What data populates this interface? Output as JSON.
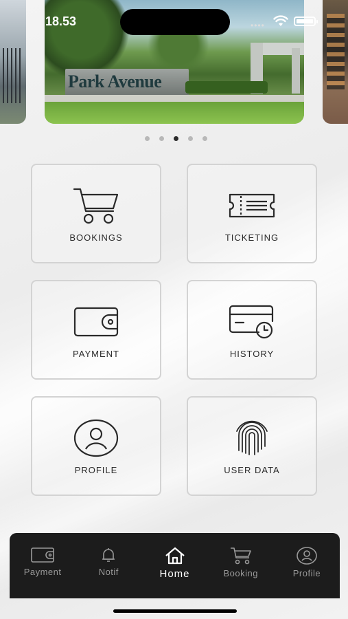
{
  "status_bar": {
    "time": "18.53"
  },
  "carousel": {
    "sign_text": "Park Avenue",
    "dot_count": 5,
    "active_index": 2
  },
  "menu": {
    "bookings": "BOOKINGS",
    "ticketing": "TICKETING",
    "payment": "PAYMENT",
    "history": "HISTORY",
    "profile": "PROFILE",
    "user_data": "USER DATA"
  },
  "nav": {
    "payment": "Payment",
    "notif": "Notif",
    "home": "Home",
    "booking": "Booking",
    "profile": "Profile",
    "active": "home"
  },
  "colors": {
    "nav_bg": "#1c1c1c",
    "card_border": "#d3d3d3",
    "active": "#ffffff",
    "inactive": "#9a9a9a"
  }
}
